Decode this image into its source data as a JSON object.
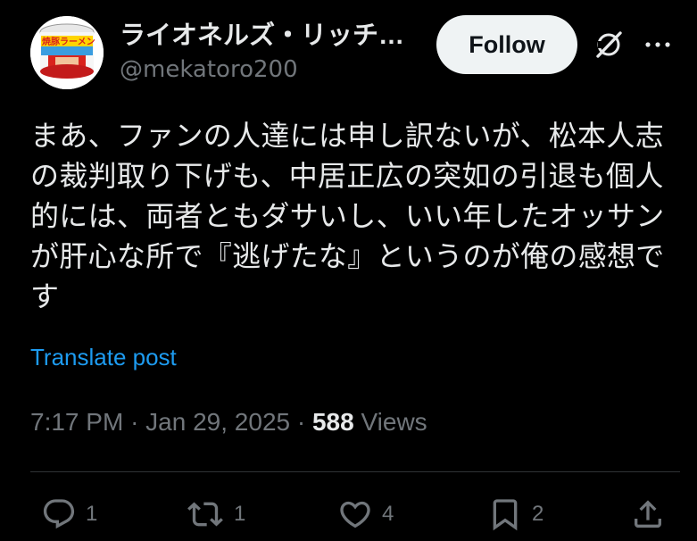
{
  "author": {
    "display_name": "ライオネルズ・リッチ…",
    "handle": "@mekatoro200",
    "avatar_text": "焼豚ラーメン"
  },
  "header": {
    "follow_label": "Follow",
    "icons": [
      "grok-icon",
      "more-icon"
    ]
  },
  "post": {
    "text": "まあ、ファンの人達には申し訳ないが、松本人志の裁判取り下げも、中居正広の突如の引退も個人的には、両者ともダサいし、いい年したオッサンが肝心な所で『逃げたな』というのが俺の感想です",
    "translate_label": "Translate post",
    "time": "7:17 PM",
    "separator": "·",
    "date": "Jan 29, 2025",
    "views_count": "588",
    "views_label": "Views"
  },
  "actions": {
    "reply_count": "1",
    "repost_count": "1",
    "like_count": "4",
    "bookmark_count": "2"
  },
  "colors": {
    "background": "#000000",
    "text": "#e7e9ea",
    "secondary": "#71767b",
    "link": "#1d9bf0",
    "button_bg": "#eff3f4",
    "divider": "#2f3336"
  }
}
